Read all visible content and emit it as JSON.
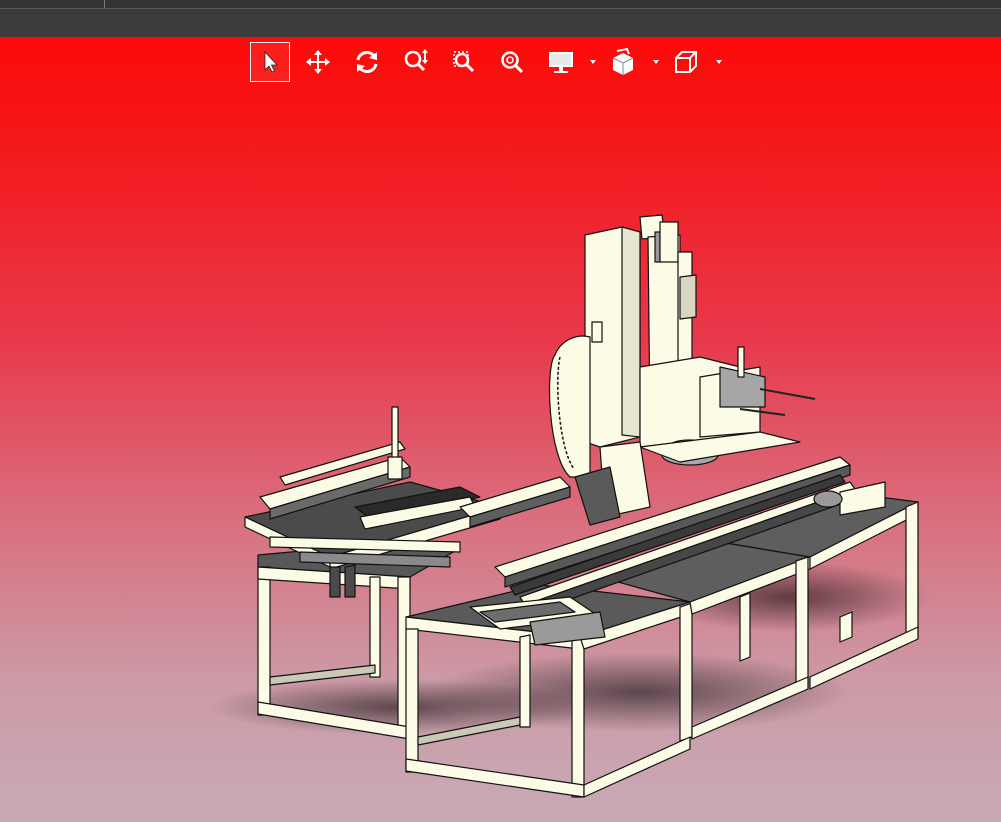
{
  "window": {
    "tab_title": ""
  },
  "toolbar": {
    "tools": [
      {
        "name": "select",
        "icon": "cursor-arrow-icon",
        "active": true
      },
      {
        "name": "pan",
        "icon": "pan-move-icon"
      },
      {
        "name": "rotate",
        "icon": "rotate-icon"
      },
      {
        "name": "zoom",
        "icon": "zoom-icon"
      },
      {
        "name": "zoom-window",
        "icon": "zoom-window-icon"
      },
      {
        "name": "zoom-fit",
        "icon": "zoom-fit-icon"
      },
      {
        "name": "display-mode",
        "icon": "monitor-icon",
        "has_dropdown": true
      },
      {
        "name": "section-view",
        "icon": "section-view-icon",
        "has_dropdown": true
      },
      {
        "name": "standard-views",
        "icon": "cube-view-icon",
        "has_dropdown": true
      }
    ]
  },
  "colors": {
    "background_top": "#ff0a0a",
    "background_bottom": "#c8aab5",
    "model_fill": "#fbfbe6",
    "model_edges": "#111111",
    "titlebar": "#3b3b3b",
    "icons": "#ffffff"
  },
  "model": {
    "icon": "automation-machine-3d-model"
  }
}
